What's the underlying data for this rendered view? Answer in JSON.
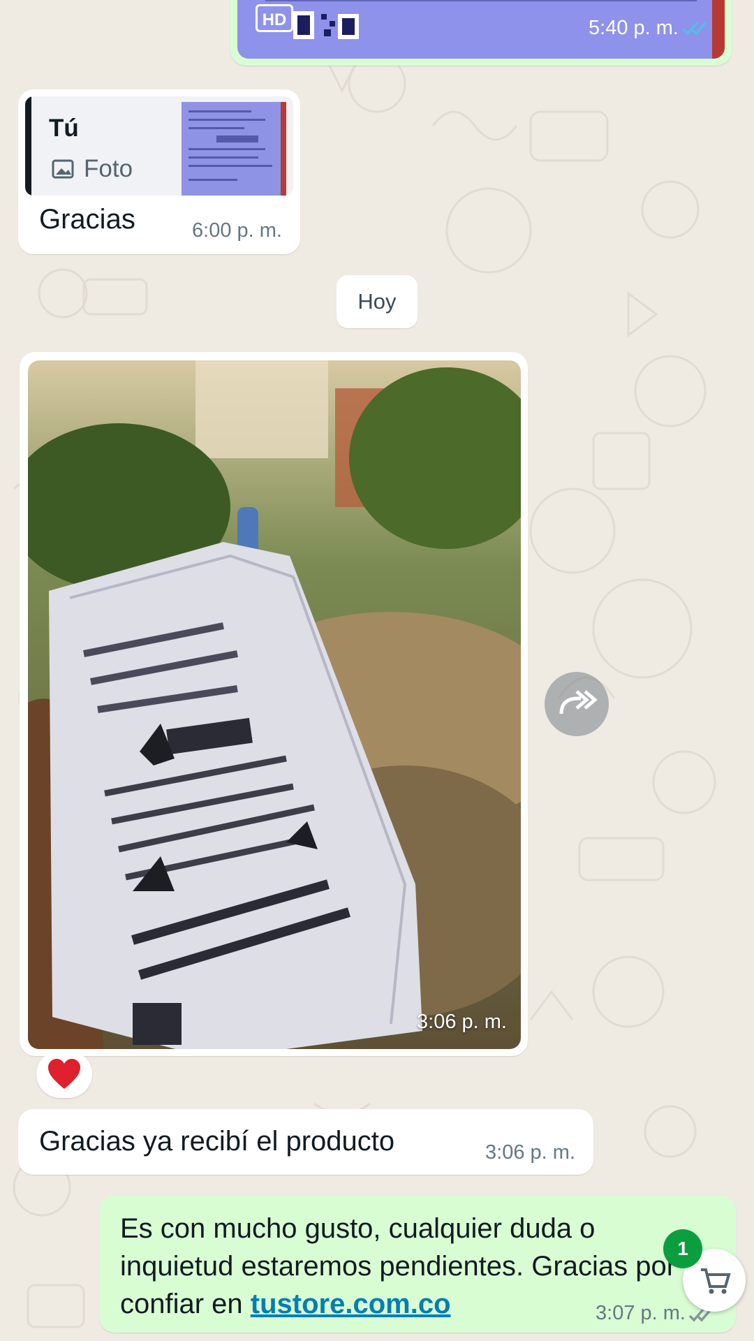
{
  "colors": {
    "chat_background": "#efeae2",
    "incoming_bubble": "#ffffff",
    "outgoing_bubble": "#d9fdd3",
    "timestamp": "#667781",
    "link": "#027eb5",
    "read_ticks": "#53bdeb",
    "badge": "#0a9e3f"
  },
  "messages": {
    "top_image": {
      "badge": "HD",
      "time": "5:40 p. m.",
      "status_icon": "double-check-read-icon"
    },
    "reply": {
      "quoted_author": "Tú",
      "quoted_type": "Foto",
      "quoted_type_icon": "image-icon",
      "text": "Gracias",
      "time": "6:00 p. m."
    },
    "date_divider": "Hoy",
    "photo": {
      "time": "3:06 p. m.",
      "reaction": "❤️",
      "forward_icon": "forward-icon"
    },
    "received_text": {
      "text": "Gracias ya recibí el producto",
      "time": "3:06 p. m."
    },
    "sent_text": {
      "text_before_link": "Es con mucho gusto, cualquier duda o inquietud estaremos pendientes. Gracias por confiar en ",
      "link": "tustore.com.co",
      "time": "3:07 p. m.",
      "status_icon": "double-check-delivered-icon"
    }
  },
  "cart": {
    "icon": "cart-icon",
    "badge_count": "1"
  }
}
